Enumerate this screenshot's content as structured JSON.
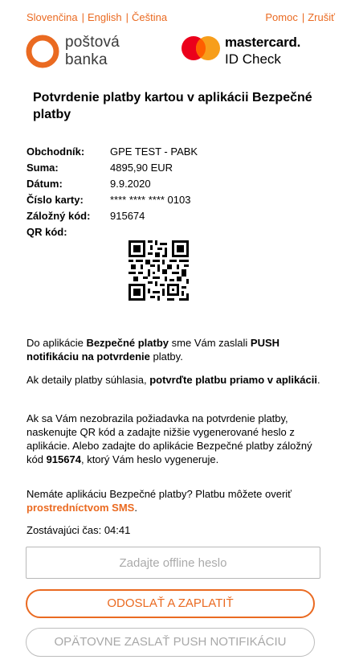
{
  "top_links": {
    "lang_sk": "Slovenčina",
    "lang_en": "English",
    "lang_cz": "Čeština",
    "sep": "|",
    "help": "Pomoc",
    "cancel": "Zrušiť"
  },
  "bank_logo": {
    "line1": "poštová",
    "line2": "banka",
    "ring_color": "#ea6a21"
  },
  "mc_logo": {
    "name": "mastercard.",
    "check": "ID Check",
    "red": "#eb001b",
    "orange": "#f79e1b",
    "yellow": "#ff5f00"
  },
  "title": "Potvrdenie platby kartou v aplikácii Bezpečné platby",
  "details": {
    "merchant_label": "Obchodník:",
    "merchant": "GPE TEST - PABK",
    "amount_label": "Suma:",
    "amount": "4895,90 EUR",
    "date_label": "Dátum:",
    "date": "9.9.2020",
    "card_label": "Číslo karty:",
    "card": "**** **** **** 0103",
    "backup_label": "Záložný kód:",
    "backup": "915674",
    "qr_label": "QR kód:"
  },
  "msg1": {
    "a": "Do aplikácie ",
    "b": "Bezpečné platby",
    "c": " sme Vám zaslali ",
    "d": "PUSH notifikáciu na potvrdenie",
    "e": " platby."
  },
  "msg2": {
    "a": "Ak detaily platby súhlasia, ",
    "b": "potvrďte platbu priamo v aplikácii",
    "c": "."
  },
  "msg3": {
    "a": "Ak sa Vám nezobrazila požiadavka na potvrdenie platby, naskenujte QR kód a zadajte nižšie vygenerované heslo z aplikácie. Alebo zadajte do aplikácie Bezpečné platby záložný kód ",
    "b": "915674",
    "c": ", ktorý Vám heslo vygeneruje."
  },
  "msg4": {
    "a": "Nemáte aplikáciu Bezpečné platby? Platbu môžete overiť ",
    "b": "prostredníctvom SMS",
    "c": "."
  },
  "timer": "Zostávajúci čas: 04:41",
  "password_input": {
    "placeholder": "Zadajte offline heslo",
    "value": ""
  },
  "pay_button": "ODOSLAŤ A ZAPLATIŤ",
  "resend_button": "OPÄTOVNE ZASLAŤ PUSH NOTIFIKÁCIU",
  "accent_color": "#ea6a21"
}
